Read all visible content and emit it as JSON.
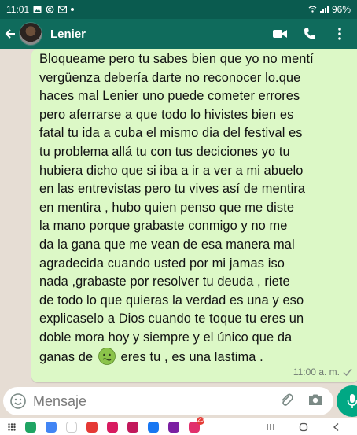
{
  "status_bar": {
    "time": "11:01",
    "battery": "96%"
  },
  "header": {
    "contact_name": "Lenier"
  },
  "message": {
    "text_before_emoji": "Bloqueame pero tu sabes bien que yo no mentí\nvergüenza debería darte no reconocer lo.que\nhaces mal Lenier uno puede cometer errores\npero aferrarse a que todo lo hivistes bien es\nfatal tu ida a cuba el mismo dia del festival es\ntu problema allá tu con tus deciciones yo tu\nhubiera dicho que si iba a ir a ver a mi abuelo\nen las entrevistas pero tu vives así de mentira\nen mentira , hubo quien penso que me diste\nla mano porque grabaste conmigo y no me\nda la gana que me vean de esa manera mal\nagradecida  cuando usted por mi jamas iso\nnada ,grabaste por resolver tu deuda , riete\nde todo lo que quieras la verdad es una y eso\nexplicaselo a Dios cuando te toque tu eres un\ndoble mora hoy y siempre y el único que da\nganas de ",
    "emoji": "nauseated-face-emoji",
    "text_after_emoji": " eres tu , es una lastima .",
    "time": "11:00 a. m."
  },
  "composer": {
    "placeholder": "Mensaje"
  },
  "nav": {
    "badge_1": "20"
  },
  "colors": {
    "header_bg": "#0f6b5c",
    "bubble_bg": "#dcf8c6",
    "mic_bg": "#00a884"
  }
}
